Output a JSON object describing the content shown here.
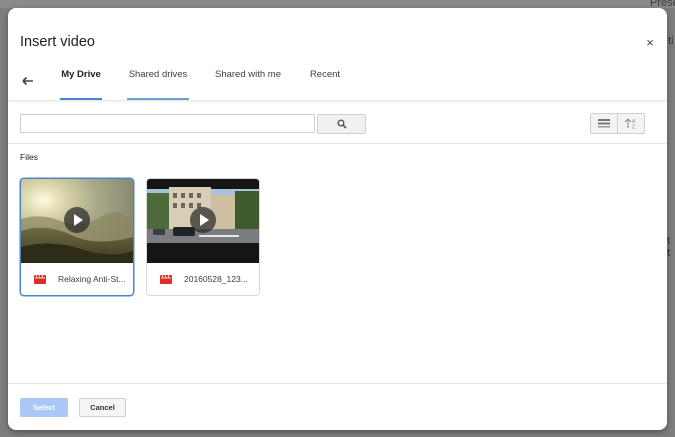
{
  "dialog": {
    "title": "Insert video",
    "close_glyph": "×"
  },
  "tabs": [
    {
      "label": "My Drive",
      "active": true
    },
    {
      "label": "Shared drives",
      "active": false
    },
    {
      "label": "Shared with me",
      "active": false
    },
    {
      "label": "Recent",
      "active": false
    }
  ],
  "search": {
    "value": "",
    "placeholder": ""
  },
  "section": {
    "label": "Files"
  },
  "files": [
    {
      "name": "Relaxing Anti-St...",
      "selected": true,
      "icon": "video-file-icon"
    },
    {
      "name": "20160528_123...",
      "selected": false,
      "icon": "video-file-icon"
    }
  ],
  "footer": {
    "select_label": "Select",
    "cancel_label": "Cancel"
  },
  "background": {
    "frag_top": "Prese",
    "frag_side1": "ti",
    "frag_side2": "t t"
  },
  "colors": {
    "accent": "#4a86c7",
    "select_disabled": "#a9c8f5",
    "file_icon": "#d93025"
  }
}
